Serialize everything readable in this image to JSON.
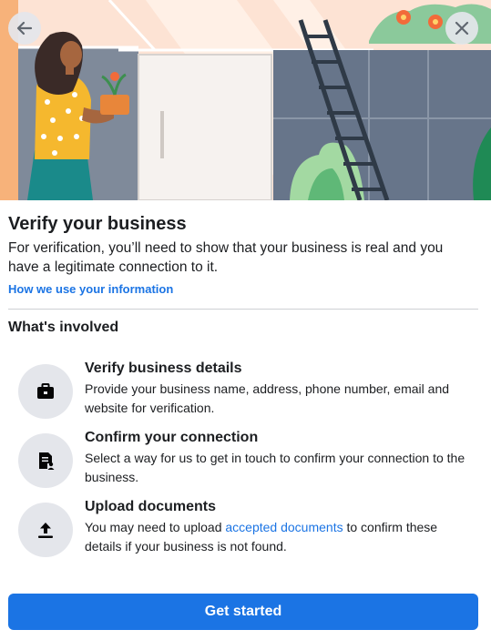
{
  "header": {
    "back_icon": "arrow-left-icon",
    "close_icon": "close-icon"
  },
  "intro": {
    "title": "Verify your business",
    "subtitle": "For verification, you’ll need to show that your business is real and you have a legitimate connection to it.",
    "info_link": "How we use your information"
  },
  "involved": {
    "heading": "What's involved",
    "steps": [
      {
        "icon": "briefcase-icon",
        "title": "Verify business details",
        "description": "Provide your business name, address, phone number, email and website for verification."
      },
      {
        "icon": "document-person-icon",
        "title": "Confirm your connection",
        "description": "Select a way for us to get in touch to confirm your connection to the business."
      },
      {
        "icon": "upload-icon",
        "title": "Upload documents",
        "description_before": "You may need to upload ",
        "description_link": "accepted documents",
        "description_after": " to confirm these details if your business is not found."
      }
    ]
  },
  "footer": {
    "primary_button": "Get started"
  },
  "colors": {
    "accent": "#1b74e4",
    "icon_background": "#e4e6eb",
    "hero_background": "#fde3d4"
  }
}
